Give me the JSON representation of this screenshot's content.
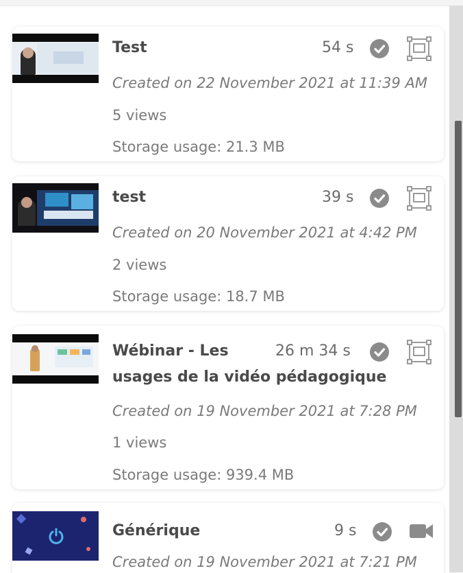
{
  "videos": [
    {
      "title": "Test",
      "duration": "54 s",
      "created": "Created on 22 November 2021 at 11:39 AM",
      "views": "5 views",
      "storage": "Storage usage: 21.3 MB",
      "status_icon": "check-circle-icon",
      "type_icon": "screen-recording-icon"
    },
    {
      "title": "test",
      "duration": "39 s",
      "created": "Created on 20 November 2021 at 4:42 PM",
      "views": "2 views",
      "storage": "Storage usage: 18.7 MB",
      "status_icon": "check-circle-icon",
      "type_icon": "screen-recording-icon"
    },
    {
      "title_line1": "Wébinar - Les",
      "title_line2": "usages de la vidéo pédagogique",
      "duration": "26 m 34 s",
      "created": "Created on 19 November 2021 at 7:28 PM",
      "views": "1 views",
      "storage": "Storage usage: 939.4 MB",
      "status_icon": "check-circle-icon",
      "type_icon": "screen-recording-icon"
    },
    {
      "title": "Générique",
      "duration": "9 s",
      "created": "Created on 19 November 2021 at 7:21 PM",
      "status_icon": "check-circle-icon",
      "type_icon": "video-camera-icon"
    }
  ],
  "colors": {
    "scroll_thumb": "#636363",
    "scroll_track": "#dcdcdc",
    "icon_gray": "#8b8b8b"
  }
}
